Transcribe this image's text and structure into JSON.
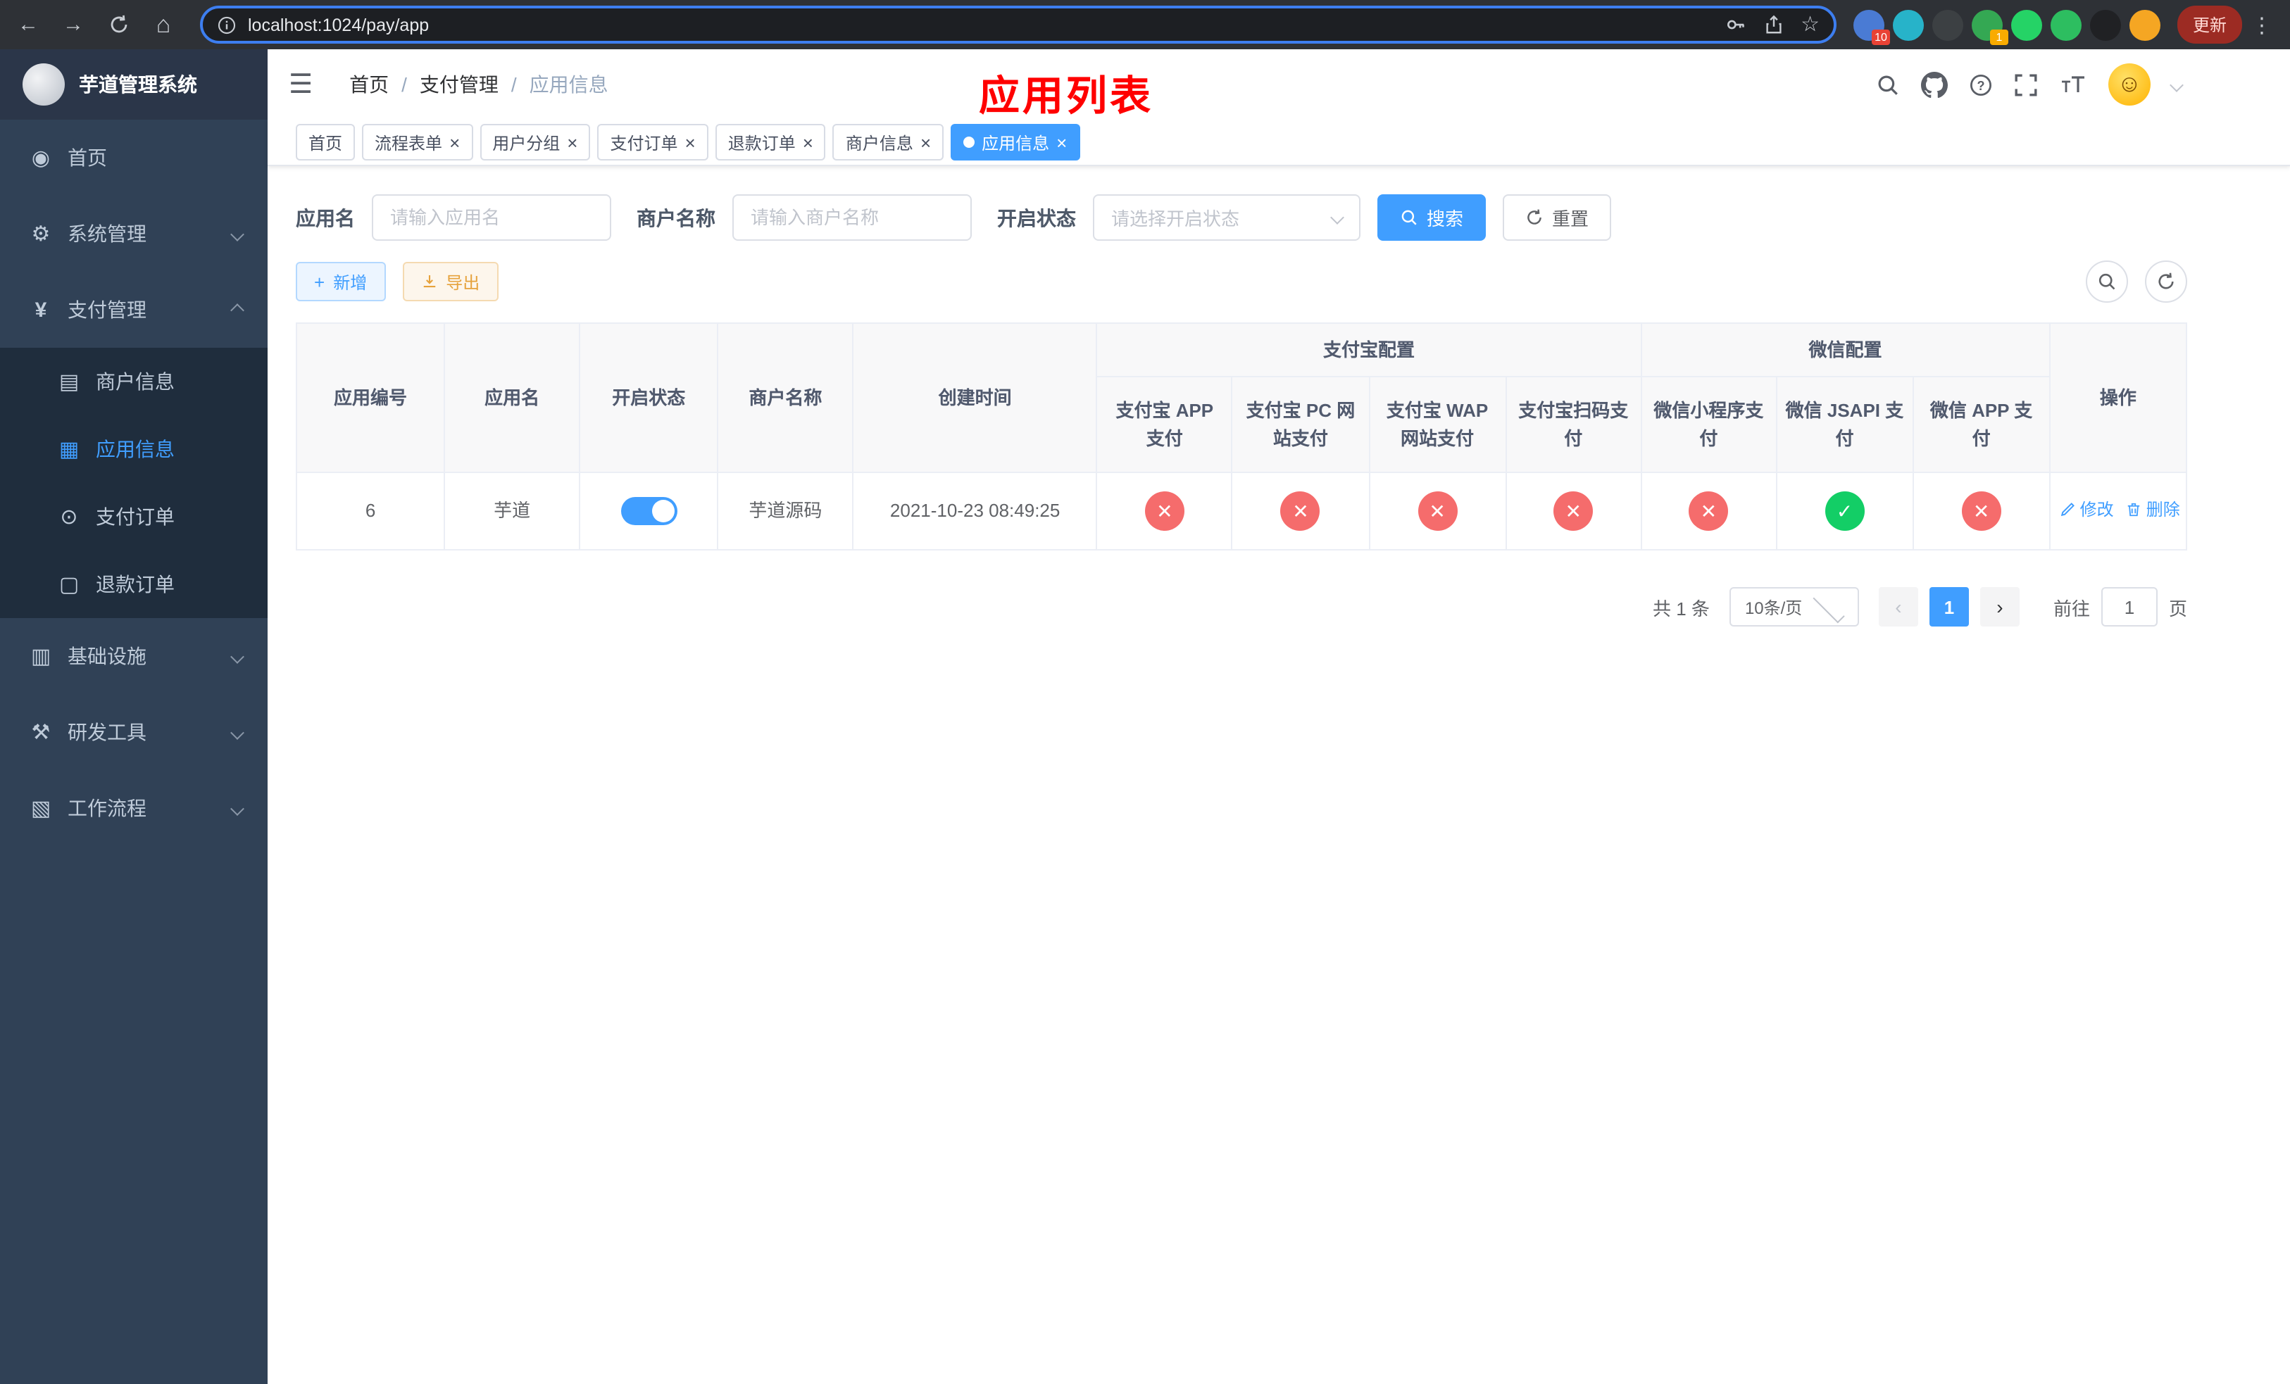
{
  "theme": {
    "accent": "#409eff",
    "danger": "#f56c6c",
    "success": "#13ce66",
    "warning": "#e6a23c",
    "title-red": "#ff0000",
    "sidebar-bg": "#304156",
    "submenu-bg": "#1f2d3d"
  },
  "browser": {
    "url": "localhost:1024/pay/app",
    "update_label": "更新",
    "extensions": [
      {
        "name": "extension-blue",
        "color": "#4a7bd4",
        "badge": "10",
        "badge_color": "#e94235"
      },
      {
        "name": "extension-teal",
        "color": "#27b3c9"
      },
      {
        "name": "extension-dark",
        "color": "#3c4043"
      },
      {
        "name": "extension-green-person",
        "color": "#34a853",
        "badge": "1",
        "badge_color": "#f9ab00"
      },
      {
        "name": "extension-green-chat",
        "color": "#25d366"
      },
      {
        "name": "extension-green-square",
        "color": "#2dbe60"
      },
      {
        "name": "extension-black",
        "color": "#202124"
      },
      {
        "name": "extension-face",
        "color": "#f5a623"
      }
    ]
  },
  "sidebar": {
    "logo_title": "芋道管理系统",
    "items": [
      {
        "label": "首页"
      },
      {
        "label": "系统管理"
      },
      {
        "label": "支付管理",
        "children": [
          {
            "label": "商户信息"
          },
          {
            "label": "应用信息",
            "active": true
          },
          {
            "label": "支付订单"
          },
          {
            "label": "退款订单"
          }
        ]
      },
      {
        "label": "基础设施"
      },
      {
        "label": "研发工具"
      },
      {
        "label": "工作流程"
      }
    ]
  },
  "header": {
    "breadcrumb": [
      "首页",
      "支付管理",
      "应用信息"
    ],
    "page_title": "应用列表"
  },
  "tabs": [
    {
      "label": "首页"
    },
    {
      "label": "流程表单"
    },
    {
      "label": "用户分组"
    },
    {
      "label": "支付订单"
    },
    {
      "label": "退款订单"
    },
    {
      "label": "商户信息"
    },
    {
      "label": "应用信息",
      "active": true
    }
  ],
  "filters": {
    "app_name_label": "应用名",
    "app_name_placeholder": "请输入应用名",
    "merchant_label": "商户名称",
    "merchant_placeholder": "请输入商户名称",
    "status_label": "开启状态",
    "status_placeholder": "请选择开启状态",
    "search_label": "搜索",
    "reset_label": "重置"
  },
  "toolbar": {
    "add_label": "新增",
    "export_label": "导出"
  },
  "table": {
    "group_headers": {
      "alipay": "支付宝配置",
      "wechat": "微信配置"
    },
    "columns": [
      "应用编号",
      "应用名",
      "开启状态",
      "商户名称",
      "创建时间",
      "支付宝 APP 支付",
      "支付宝 PC 网站支付",
      "支付宝 WAP 网站支付",
      "支付宝扫码支付",
      "微信小程序支付",
      "微信 JSAPI 支付",
      "微信 APP 支付",
      "操作"
    ],
    "rows": [
      {
        "id": "6",
        "name": "芋道",
        "status_on": true,
        "merchant": "芋道源码",
        "created": "2021-10-23 08:49:25",
        "configs": [
          "no",
          "no",
          "no",
          "no",
          "no",
          "yes",
          "no"
        ],
        "actions": [
          "修改",
          "删除"
        ]
      }
    ]
  },
  "pagination": {
    "total_text": "共 1 条",
    "page_size": "10条/页",
    "current_page": "1",
    "goto_prefix": "前往",
    "goto_value": "1",
    "goto_suffix": "页"
  }
}
